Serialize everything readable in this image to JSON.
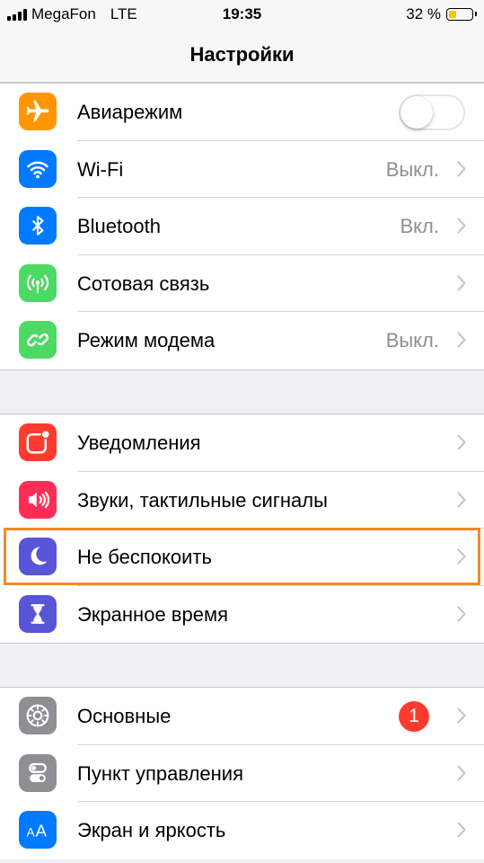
{
  "status": {
    "carrier": "MegaFon",
    "network": "LTE",
    "time": "19:35",
    "battery": "32 %",
    "battery_level": 0.32
  },
  "nav": {
    "title": "Настройки"
  },
  "group1": [
    {
      "id": "airplane",
      "label": "Авиарежим",
      "icon": "airplane-icon",
      "color": "#ff9500",
      "toggle": false
    },
    {
      "id": "wifi",
      "label": "Wi-Fi",
      "value": "Выкл.",
      "icon": "wifi-icon",
      "color": "#007aff"
    },
    {
      "id": "bluetooth",
      "label": "Bluetooth",
      "value": "Вкл.",
      "icon": "bluetooth-icon",
      "color": "#007aff"
    },
    {
      "id": "cellular",
      "label": "Сотовая связь",
      "icon": "antenna-icon",
      "color": "#4cd964"
    },
    {
      "id": "hotspot",
      "label": "Режим модема",
      "value": "Выкл.",
      "icon": "hotspot-icon",
      "color": "#4cd964"
    }
  ],
  "group2": [
    {
      "id": "notifications",
      "label": "Уведомления",
      "icon": "notifications-icon",
      "color": "#ff3b30"
    },
    {
      "id": "sounds",
      "label": "Звуки, тактильные сигналы",
      "icon": "speaker-icon",
      "color": "#ff2d55"
    },
    {
      "id": "dnd",
      "label": "Не беспокоить",
      "icon": "moon-icon",
      "color": "#5856d6"
    },
    {
      "id": "screentime",
      "label": "Экранное время",
      "icon": "hourglass-icon",
      "color": "#5856d6"
    }
  ],
  "group3": [
    {
      "id": "general",
      "label": "Основные",
      "badge": "1",
      "icon": "gear-icon",
      "color": "#8e8e93"
    },
    {
      "id": "control",
      "label": "Пункт управления",
      "icon": "switches-icon",
      "color": "#8e8e93"
    },
    {
      "id": "display",
      "label": "Экран и яркость",
      "icon": "text-size-icon",
      "color": "#007aff"
    }
  ],
  "highlight_color": "#f0892c"
}
